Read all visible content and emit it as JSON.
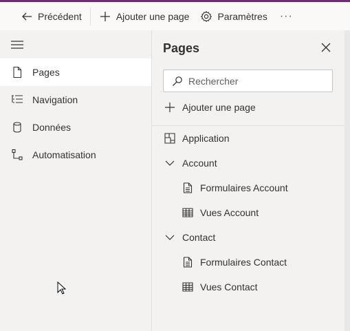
{
  "toolbar": {
    "back_label": "Précédent",
    "add_page_label": "Ajouter une page",
    "settings_label": "Paramètres",
    "more_label": "···"
  },
  "leftnav": {
    "items": [
      {
        "label": "Pages",
        "icon": "page-icon",
        "selected": true
      },
      {
        "label": "Navigation",
        "icon": "navigation-list-icon",
        "selected": false
      },
      {
        "label": "Données",
        "icon": "database-icon",
        "selected": false
      },
      {
        "label": "Automatisation",
        "icon": "flow-icon",
        "selected": false
      }
    ]
  },
  "panel": {
    "title": "Pages",
    "search_placeholder": "Rechercher",
    "add_page_label": "Ajouter une page",
    "tree": [
      {
        "label": "Application",
        "icon": "app-layout-icon",
        "level": 0
      },
      {
        "label": "Account",
        "icon": "chevron-down-icon",
        "level": 0
      },
      {
        "label": "Formulaires Account",
        "icon": "form-icon",
        "level": 1
      },
      {
        "label": "Vues Account",
        "icon": "table-icon",
        "level": 1
      },
      {
        "label": "Contact",
        "icon": "chevron-down-icon",
        "level": 0
      },
      {
        "label": "Formulaires Contact",
        "icon": "form-icon",
        "level": 1
      },
      {
        "label": "Vues Contact",
        "icon": "table-icon",
        "level": 1
      }
    ]
  },
  "colors": {
    "accent": "#742774",
    "selected_bg": "#ffffff",
    "background": "#f3f2f1"
  }
}
